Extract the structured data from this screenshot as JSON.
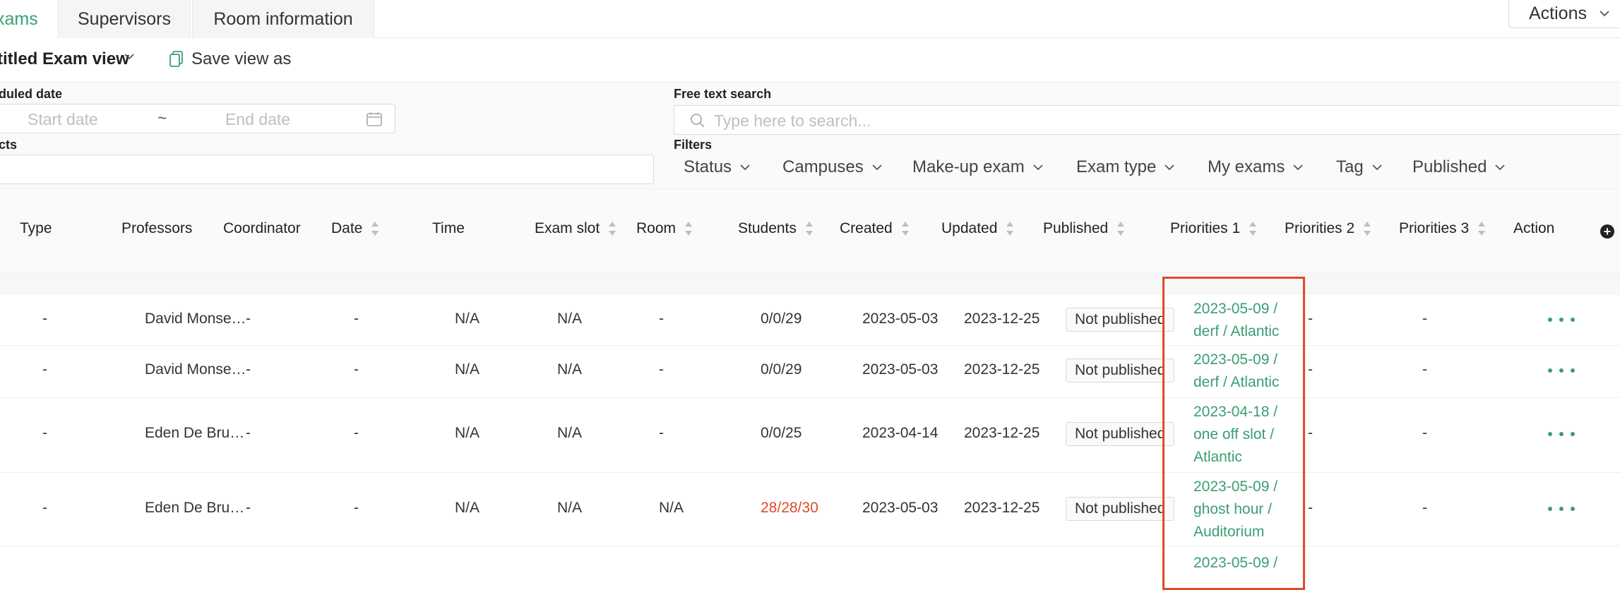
{
  "tabs": [
    "xams",
    "Supervisors",
    "Room information"
  ],
  "actions_label": "Actions",
  "view": {
    "title": "titled Exam view",
    "save_label": "Save view as"
  },
  "filters": {
    "date_label": "duled date",
    "start_placeholder": "Start date",
    "tilde": "~",
    "end_placeholder": "End date",
    "subjects_label": "cts",
    "free_text_label": "Free text search",
    "search_placeholder": "Type here to search...",
    "filters_label": "Filters",
    "dropdowns": [
      "Status",
      "Campuses",
      "Make-up exam",
      "Exam type",
      "My exams",
      "Tag",
      "Published"
    ]
  },
  "columns": [
    "Type",
    "Professors",
    "Coordinator",
    "Date",
    "Time",
    "Exam slot",
    "Room",
    "Students",
    "Created",
    "Updated",
    "Published",
    "Priorities 1",
    "Priorities 2",
    "Priorities 3",
    "Action"
  ],
  "rows": [
    {
      "type": "-",
      "professor": "David Monse…",
      "coordinator": "-",
      "date": "-",
      "time": "N/A",
      "slot": "N/A",
      "room": "-",
      "students": "0/0/29",
      "students_alert": false,
      "created": "2023-05-03",
      "updated": "2023-12-25",
      "published": "Not published",
      "prio1": [
        "2023-05-09 /",
        "derf / Atlantic"
      ],
      "prio2": "-",
      "prio3": "-"
    },
    {
      "type": "-",
      "professor": "David Monse…",
      "coordinator": "-",
      "date": "-",
      "time": "N/A",
      "slot": "N/A",
      "room": "-",
      "students": "0/0/29",
      "students_alert": false,
      "created": "2023-05-03",
      "updated": "2023-12-25",
      "published": "Not published",
      "prio1": [
        "2023-05-09 /",
        "derf / Atlantic"
      ],
      "prio2": "-",
      "prio3": "-"
    },
    {
      "type": "-",
      "professor": "Eden De Bru…",
      "coordinator": "-",
      "date": "-",
      "time": "N/A",
      "slot": "N/A",
      "room": "-",
      "students": "0/0/25",
      "students_alert": false,
      "created": "2023-04-14",
      "updated": "2023-12-25",
      "published": "Not published",
      "prio1": [
        "2023-04-18 /",
        "one off slot /",
        "Atlantic"
      ],
      "prio2": "-",
      "prio3": "-"
    },
    {
      "type": "-",
      "professor": "Eden De Bru…",
      "coordinator": "-",
      "date": "-",
      "time": "N/A",
      "slot": "N/A",
      "room": "N/A",
      "students": "28/28/30",
      "students_alert": true,
      "created": "2023-05-03",
      "updated": "2023-12-25",
      "published": "Not published",
      "prio1": [
        "2023-05-09 /",
        "ghost hour /",
        "Auditorium"
      ],
      "prio2": "-",
      "prio3": "-"
    }
  ],
  "partial_row_prio": "2023-05-09 /",
  "colors": {
    "accent": "#3a9e72",
    "alert": "#e04a2a",
    "highlight_border": "#e04a2a"
  }
}
